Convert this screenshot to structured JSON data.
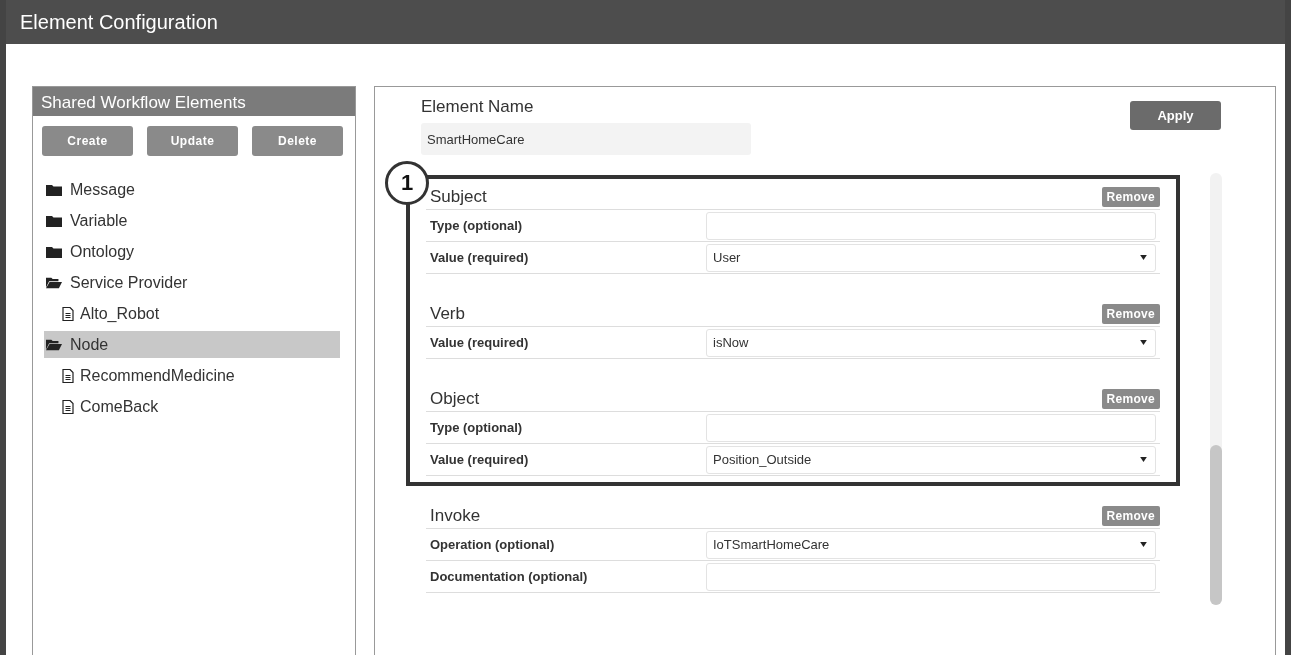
{
  "window": {
    "title": "Element Configuration"
  },
  "sidebar": {
    "title": "Shared Workflow Elements",
    "buttons": [
      "Create",
      "Update",
      "Delete"
    ],
    "tree": [
      {
        "label": "Message",
        "kind": "folder",
        "expanded": false,
        "selected": false
      },
      {
        "label": "Variable",
        "kind": "folder",
        "expanded": false,
        "selected": false
      },
      {
        "label": "Ontology",
        "kind": "folder",
        "expanded": false,
        "selected": false
      },
      {
        "label": "Service Provider",
        "kind": "folder",
        "expanded": true,
        "selected": false,
        "children": [
          {
            "label": "Alto_Robot",
            "kind": "file",
            "selected": false
          }
        ]
      },
      {
        "label": "Node",
        "kind": "folder",
        "expanded": true,
        "selected": true,
        "children": [
          {
            "label": "RecommendMedicine",
            "kind": "file",
            "selected": false
          },
          {
            "label": "ComeBack",
            "kind": "file",
            "selected": false
          }
        ]
      }
    ]
  },
  "editor": {
    "name_label": "Element Name",
    "name_value": "SmartHomeCare",
    "apply": "Apply",
    "annotation": "1",
    "sections": [
      {
        "title": "Subject",
        "annotated": true,
        "remove": "Remove",
        "fields": [
          {
            "label": "Type (optional)",
            "kind": "text"
          },
          {
            "label": "Value (required)",
            "kind": "select",
            "value": "User"
          }
        ]
      },
      {
        "title": "Verb",
        "annotated": true,
        "remove": "Remove",
        "fields": [
          {
            "label": "Value (required)",
            "kind": "select",
            "value": "isNow"
          }
        ]
      },
      {
        "title": "Object",
        "annotated": true,
        "remove": "Remove",
        "fields": [
          {
            "label": "Type (optional)",
            "kind": "text"
          },
          {
            "label": "Value (required)",
            "kind": "select",
            "value": "Position_Outside"
          }
        ]
      },
      {
        "title": "Invoke",
        "annotated": false,
        "remove": "Remove",
        "fields": [
          {
            "label": "Operation (optional)",
            "kind": "select",
            "value": "IoTSmartHomeCare"
          },
          {
            "label": "Documentation (optional)",
            "kind": "text"
          }
        ]
      }
    ]
  }
}
